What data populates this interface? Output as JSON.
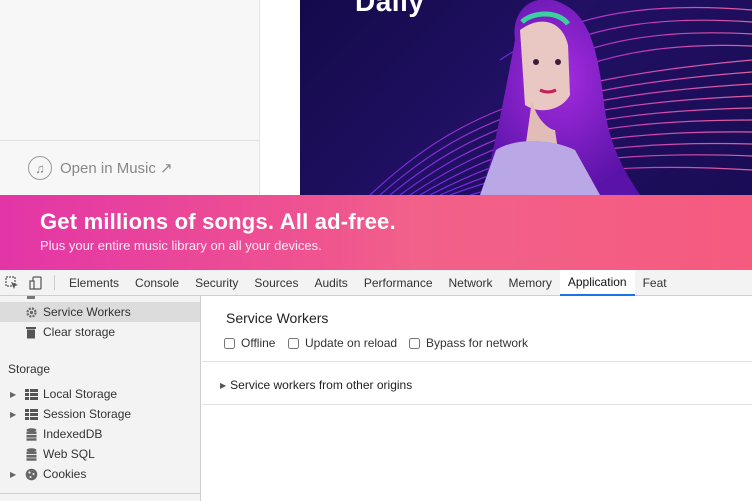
{
  "web": {
    "open_in_music": "Open in Music ↗",
    "artwork_title": "Daily"
  },
  "banner": {
    "title": "Get millions of songs. All ad-free.",
    "subtitle": "Plus your entire music library on all your devices."
  },
  "devtools": {
    "tabs": [
      "Elements",
      "Console",
      "Security",
      "Sources",
      "Audits",
      "Performance",
      "Network",
      "Memory",
      "Application",
      "Feat"
    ],
    "active_tab": "Application",
    "sidebar": {
      "service_workers": "Service Workers",
      "clear_storage": "Clear storage",
      "storage_heading": "Storage",
      "local_storage": "Local Storage",
      "session_storage": "Session Storage",
      "indexeddb": "IndexedDB",
      "web_sql": "Web SQL",
      "cookies": "Cookies"
    },
    "main": {
      "title": "Service Workers",
      "options": {
        "offline": "Offline",
        "update_on_reload": "Update on reload",
        "bypass_for_network": "Bypass for network"
      },
      "other_origins": "Service workers from other origins"
    }
  },
  "colors": {
    "accent": "#1a73e8",
    "banner_start": "#e335a7",
    "banner_end": "#f65a7f"
  }
}
